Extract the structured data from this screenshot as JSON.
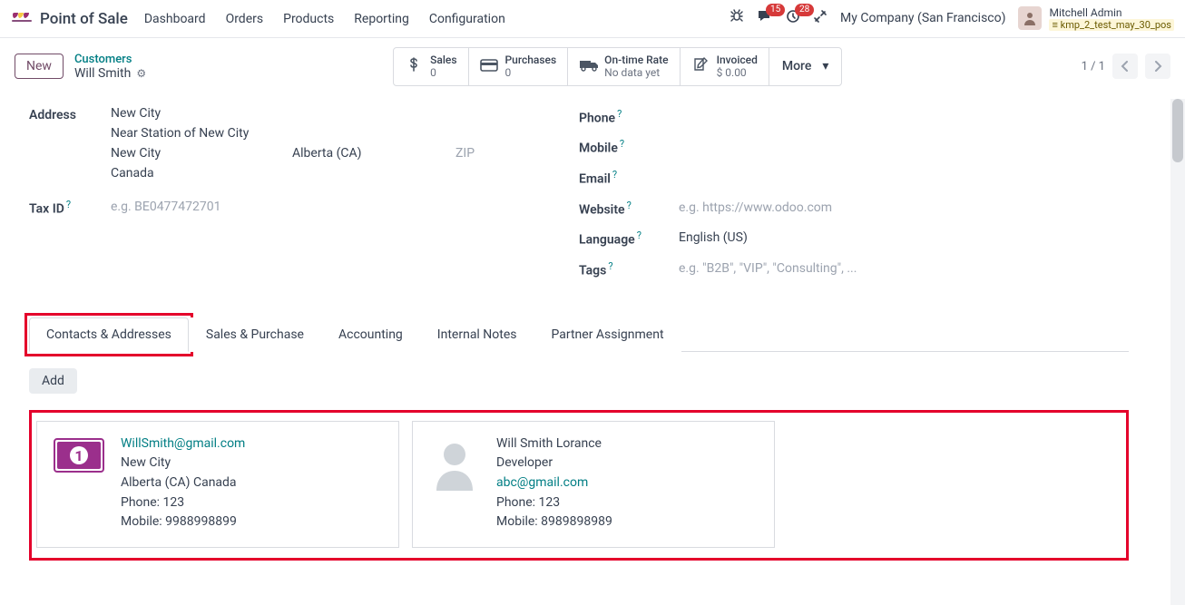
{
  "topnav": {
    "app_title": "Point of Sale",
    "links": [
      "Dashboard",
      "Orders",
      "Products",
      "Reporting",
      "Configuration"
    ],
    "messages_badge": "15",
    "activities_badge": "28",
    "company": "My Company (San Francisco)",
    "user_name": "Mitchell Admin",
    "db_name": "kmp_2_test_may_30_pos"
  },
  "subheader": {
    "new_label": "New",
    "breadcrumb_top": "Customers",
    "breadcrumb_current": "Will Smith",
    "stats": {
      "sales_label": "Sales",
      "sales_value": "0",
      "purchases_label": "Purchases",
      "purchases_value": "0",
      "otr_label": "On-time Rate",
      "otr_value": "No data yet",
      "invoiced_label": "Invoiced",
      "invoiced_value": "$ 0.00",
      "more_label": "More"
    },
    "pager": "1 / 1"
  },
  "form": {
    "address_label": "Address",
    "address": {
      "street": "New City",
      "street2": "Near Station of New City",
      "city": "New City",
      "state": "Alberta (CA)",
      "zip_placeholder": "ZIP",
      "country": "Canada"
    },
    "taxid_label": "Tax ID",
    "taxid_placeholder": "e.g. BE0477472701",
    "phone_label": "Phone",
    "mobile_label": "Mobile",
    "email_label": "Email",
    "website_label": "Website",
    "website_placeholder": "e.g. https://www.odoo.com",
    "language_label": "Language",
    "language_value": "English (US)",
    "tags_label": "Tags",
    "tags_placeholder": "e.g. \"B2B\", \"VIP\", \"Consulting\", ..."
  },
  "tabs": {
    "items": [
      "Contacts & Addresses",
      "Sales & Purchase",
      "Accounting",
      "Internal Notes",
      "Partner Assignment"
    ],
    "add_label": "Add"
  },
  "contacts": [
    {
      "type": "invoice",
      "email": "WillSmith@gmail.com",
      "city": "New City",
      "region": "Alberta (CA) Canada",
      "phone": "Phone: 123",
      "mobile": "Mobile: 9988998899"
    },
    {
      "type": "person",
      "name": "Will Smith Lorance",
      "title": "Developer",
      "email": "abc@gmail.com",
      "phone": "Phone: 123",
      "mobile": "Mobile: 8989898989"
    }
  ]
}
